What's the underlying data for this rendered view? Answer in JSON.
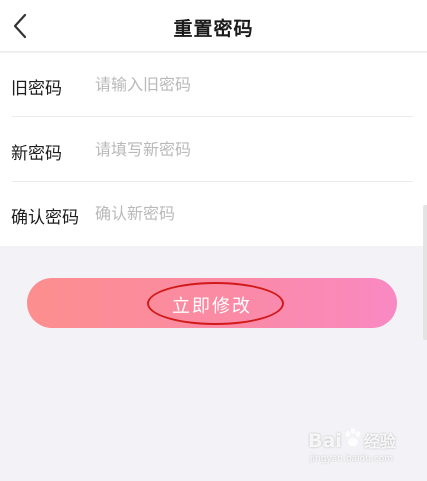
{
  "header": {
    "title": "重置密码",
    "back_icon": "chevron-left-icon"
  },
  "form": {
    "fields": [
      {
        "label": "旧密码",
        "placeholder": "请输入旧密码",
        "value": ""
      },
      {
        "label": "新密码",
        "placeholder": "请填写新密码",
        "value": ""
      },
      {
        "label": "确认密码",
        "placeholder": "确认新密码",
        "value": ""
      }
    ]
  },
  "submit": {
    "label": "立即修改",
    "gradient_start": "#fc8e8e",
    "gradient_end": "#f989c2"
  },
  "annotation": {
    "ring_color": "#d11a1a"
  },
  "watermark": {
    "brand": "Bai",
    "brand_suffix": "经验",
    "site": "jingyan.baidu.com"
  }
}
